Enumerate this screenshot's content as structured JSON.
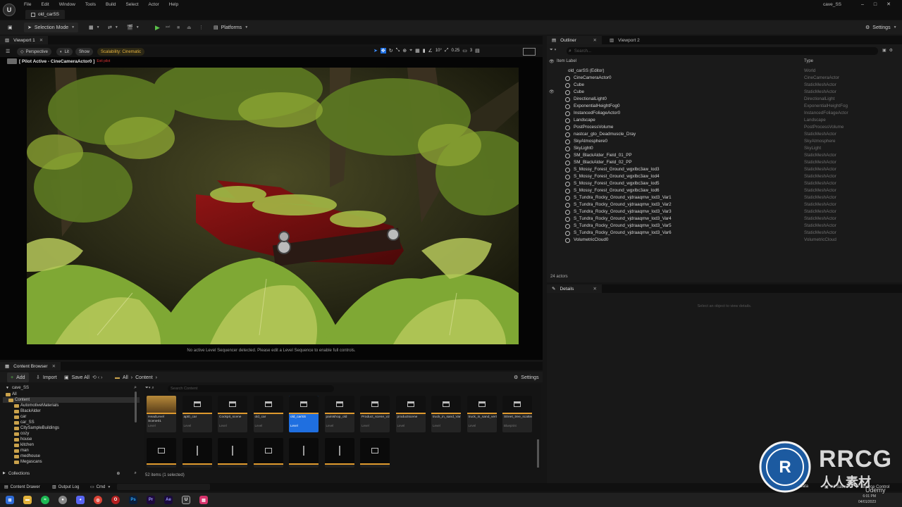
{
  "app": {
    "menu": [
      "File",
      "Edit",
      "Window",
      "Tools",
      "Build",
      "Select",
      "Actor",
      "Help"
    ],
    "level_tab": "old_carSS",
    "project_name": "cave_SS"
  },
  "toolbar": {
    "selection_mode": "Selection Mode",
    "platforms": "Platforms",
    "settings": "Settings"
  },
  "viewport": {
    "tab_label": "Viewport 1",
    "perspective": "Perspective",
    "lit": "Lit",
    "show": "Show",
    "scalability": "Scalability: Cinematic",
    "fov": "10°",
    "speed": "0.25",
    "cam_speed": "3",
    "pilot_label": "[ Pilot Active - CineCameraActor0 ]",
    "pilot_extra": "Exit pilot",
    "sequencer_msg": "No active Level Sequencer detected. Please edit a Level Sequence to enable full controls."
  },
  "outliner": {
    "tab_label": "Outliner",
    "viewport2_label": "Viewport 2",
    "search_placeholder": "Search...",
    "col_label": "Item Label",
    "col_type": "Type",
    "root": {
      "label": "old_carSS (Editor)",
      "type": "World"
    },
    "items": [
      {
        "label": "CineCameraActor0",
        "type": "CineCameraActor"
      },
      {
        "label": "Cube",
        "type": "StaticMeshActor"
      },
      {
        "label": "Cube",
        "type": "StaticMeshActor"
      },
      {
        "label": "DirectionalLight0",
        "type": "DirectionalLight"
      },
      {
        "label": "ExponentialHeightFog0",
        "type": "ExponentialHeightFog"
      },
      {
        "label": "InstancedFoliageActor0",
        "type": "InstancedFoliageActor"
      },
      {
        "label": "Landscape",
        "type": "Landscape"
      },
      {
        "label": "PostProcessVolume",
        "type": "PostProcessVolume"
      },
      {
        "label": "nastcar_gto_Deadmuscle_Dray",
        "type": "StaticMeshActor"
      },
      {
        "label": "SkyAtmosphere0",
        "type": "SkyAtmosphere"
      },
      {
        "label": "SkyLight0",
        "type": "SkyLight"
      },
      {
        "label": "SM_BlackAlder_Field_01_PP",
        "type": "StaticMeshActor"
      },
      {
        "label": "SM_BlackAlder_Field_02_PP",
        "type": "StaticMeshActor"
      },
      {
        "label": "S_Mossy_Forest_Ground_wgxlbc3aw_lod3",
        "type": "StaticMeshActor"
      },
      {
        "label": "S_Mossy_Forest_Ground_wgxlbc3aw_lod4",
        "type": "StaticMeshActor"
      },
      {
        "label": "S_Mossy_Forest_Ground_wgxlbc3aw_lod5",
        "type": "StaticMeshActor"
      },
      {
        "label": "S_Mossy_Forest_Ground_wgxlbc3aw_lod6",
        "type": "StaticMeshActor"
      },
      {
        "label": "S_Tundra_Rocky_Ground_vjdraaqmw_lod3_Var1",
        "type": "StaticMeshActor"
      },
      {
        "label": "S_Tundra_Rocky_Ground_vjdraaqmw_lod3_Var2",
        "type": "StaticMeshActor"
      },
      {
        "label": "S_Tundra_Rocky_Ground_vjdraaqmw_lod3_Var3",
        "type": "StaticMeshActor"
      },
      {
        "label": "S_Tundra_Rocky_Ground_vjdraaqmw_lod3_Var4",
        "type": "StaticMeshActor"
      },
      {
        "label": "S_Tundra_Rocky_Ground_vjdraaqmw_lod3_Var5",
        "type": "StaticMeshActor"
      },
      {
        "label": "S_Tundra_Rocky_Ground_vjdraaqmw_lod3_Var6",
        "type": "StaticMeshActor"
      },
      {
        "label": "VolumetricCloud0",
        "type": "VolumetricCloud"
      }
    ],
    "actor_count": "24 actors"
  },
  "details": {
    "tab_label": "Details",
    "hint": "Select an object to view details."
  },
  "content_browser": {
    "tab_label": "Content Browser",
    "add": "Add",
    "import": "Import",
    "save_all": "Save All",
    "crumb_all": "All",
    "crumb_content": "Content",
    "settings": "Settings",
    "search_placeholder": "Search Content",
    "project": "cave_SS",
    "tree": [
      "All",
      "Content",
      "AutomotiveMaterials",
      "BlackAlder",
      "car",
      "car_SS",
      "CitySampleBuildings",
      "cozy",
      "house",
      "kitchen",
      "man",
      "medhouse",
      "Megascans"
    ],
    "collections": "Collections",
    "assets": [
      {
        "name": "HeadLevel Scene01",
        "type": "Level",
        "selected": false
      },
      {
        "name": "apt0_car",
        "type": "Level",
        "selected": false
      },
      {
        "name": "Cockpit_scene",
        "type": "Level",
        "selected": false
      },
      {
        "name": "old_car",
        "type": "Level",
        "selected": false
      },
      {
        "name": "old_carSS",
        "type": "Level",
        "selected": true
      },
      {
        "name": "paintshop_old",
        "type": "Level",
        "selected": false
      },
      {
        "name": "Product_scene_v2",
        "type": "Level",
        "selected": false
      },
      {
        "name": "productscene",
        "type": "Level",
        "selected": false
      },
      {
        "name": "truck_in_sand_Variation2",
        "type": "Level",
        "selected": false
      },
      {
        "name": "truck_in_sand_ver02",
        "type": "Level",
        "selected": false
      },
      {
        "name": "Street_tree_scatter",
        "type": "Blueprint",
        "selected": false
      }
    ],
    "items_count": "52 items (1 selected)"
  },
  "status": {
    "content_drawer": "Content Drawer",
    "output_log": "Output Log",
    "cmd": "Cmd",
    "derived_data": "Derived Data",
    "all_saved": "All Saved",
    "source_control": "Source Control"
  },
  "taskbar": {
    "time": "6:01 PM",
    "date": "04/01/2023"
  },
  "watermark": {
    "brand": "RRCG",
    "sub": "人人素材",
    "udemy": "Udemy"
  },
  "colors": {
    "accent": "#1f6fe0",
    "warning": "#e8b440",
    "level_bar": "#e09a2e"
  }
}
